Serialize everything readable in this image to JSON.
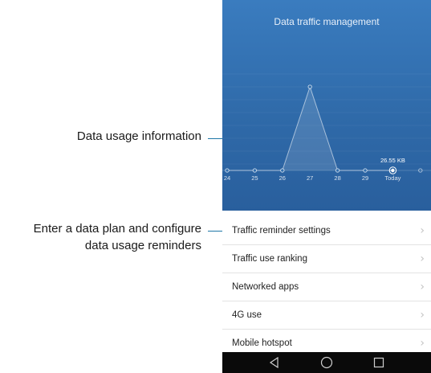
{
  "annotations": {
    "data_usage": "Data usage information",
    "plan_line1": "Enter a data plan and configure",
    "plan_line2": "data usage reminders",
    "leader_color": "#1f78a8"
  },
  "header": {
    "title": "Data traffic management",
    "bg_color": "#2f6aa9"
  },
  "chart_data": {
    "type": "line",
    "categories": [
      "24",
      "25",
      "26",
      "27",
      "28",
      "29",
      "Today"
    ],
    "values": [
      0,
      0,
      0,
      1,
      0,
      0,
      0
    ],
    "today_label": "26.55 KB"
  },
  "list": {
    "items": [
      {
        "label": "Traffic reminder settings",
        "icon": "chevron-right-icon"
      },
      {
        "label": "Traffic use ranking",
        "icon": "chevron-right-icon"
      },
      {
        "label": "Networked apps",
        "icon": "chevron-right-icon"
      },
      {
        "label": "4G use",
        "icon": "chevron-right-icon"
      },
      {
        "label": "Mobile hotspot",
        "icon": "chevron-right-icon"
      }
    ]
  },
  "navbar": {
    "buttons": [
      "back-icon",
      "home-icon",
      "recents-icon"
    ]
  }
}
